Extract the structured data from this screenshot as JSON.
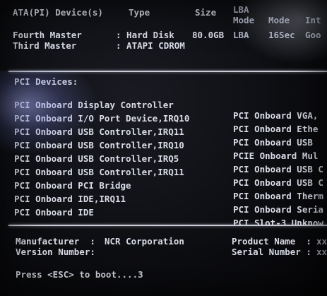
{
  "header": {
    "col_device": "ATA(PI) Device(s)",
    "col_type": "Type",
    "col_size": "Size",
    "col_lba1": "LBA",
    "col_lba2": "Mode",
    "col_mode": "Mode",
    "col_int": "Int",
    "devices": [
      {
        "name": "Fourth Master",
        "type": ": Hard Disk",
        "size": "80.0GB",
        "lba": "LBA",
        "mode": "16Sec",
        "int": "Goo"
      },
      {
        "name": "Third Master",
        "type": ": ATAPI CDROM",
        "size": "",
        "lba": "",
        "mode": "",
        "int": ""
      }
    ]
  },
  "pci": {
    "title": "PCI Devices:",
    "rows": [
      {
        "left": "PCI Onboard Display Controller",
        "right": "PCI Onboard VGA,"
      },
      {
        "left": "PCI Onboard I/O Port Device,IRQ10",
        "right": "PCI Onboard Ethe"
      },
      {
        "left": "PCI Onboard USB Controller,IRQ11",
        "right": "PCI Onboard USB"
      },
      {
        "left": "PCI Onboard USB Controller,IRQ10",
        "right": "PCIE Onboard Mul"
      },
      {
        "left": "PCI Onboard USB Controller,IRQ5",
        "right": "PCI Onboard USB C"
      },
      {
        "left": "PCI Onboard USB Controller,IRQ11",
        "right": "PCI Onboard USB C"
      },
      {
        "left": "PCI Onboard PCI Bridge",
        "right": "PCI Onboard Therm"
      },
      {
        "left": "PCI Onboard IDE,IRQ11",
        "right": "PCI Onboard Seria"
      },
      {
        "left": "PCI Onboard IDE",
        "right": "PCI Slot-3 Unknow"
      }
    ]
  },
  "footer": {
    "manufacturer_label": "Manufacturer  :",
    "manufacturer_value": "NCR Corporation",
    "version_label": "Version Number:",
    "version_value": "",
    "product_label": "Product Name  :",
    "product_value": "xx",
    "serial_label": "Serial Number :",
    "serial_value": "xx"
  },
  "boot_prompt": "Press <ESC> to boot....3"
}
